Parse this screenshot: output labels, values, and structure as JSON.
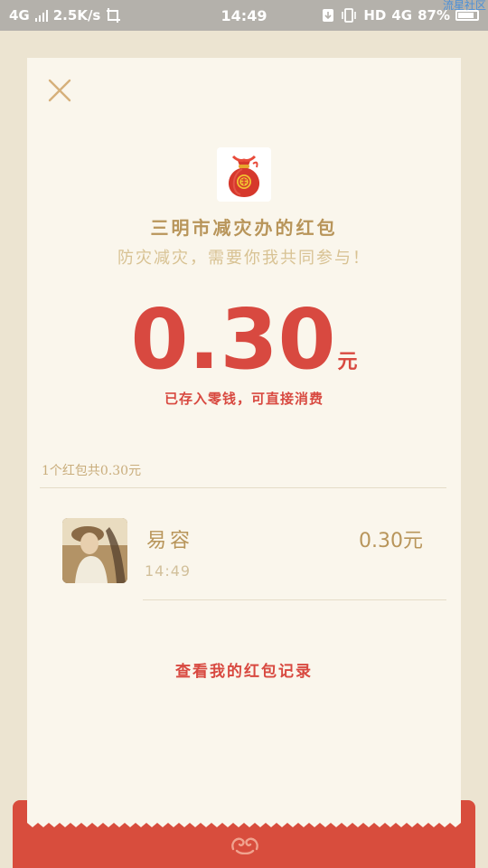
{
  "status_bar": {
    "network": "4G",
    "speed": "2.5K/s",
    "time": "14:49",
    "hd": "HD",
    "network_right": "4G",
    "battery": "87%",
    "watermark": "流星社区"
  },
  "packet": {
    "title": "三明市减灾办的红包",
    "greeting": "防灾减灾，需要你我共同参与！",
    "amount": "0.30",
    "unit": "元",
    "note": "已存入零钱，可直接消费"
  },
  "summary": "1个红包共0.30元",
  "records": [
    {
      "name": "易容",
      "time": "14:49",
      "amount": "0.30元"
    }
  ],
  "history_link": "查看我的红包记录",
  "colors": {
    "accent_red": "#d84940",
    "gold": "#b8955a",
    "card_bg": "#faf6ec",
    "page_bg": "#ece4d1"
  }
}
